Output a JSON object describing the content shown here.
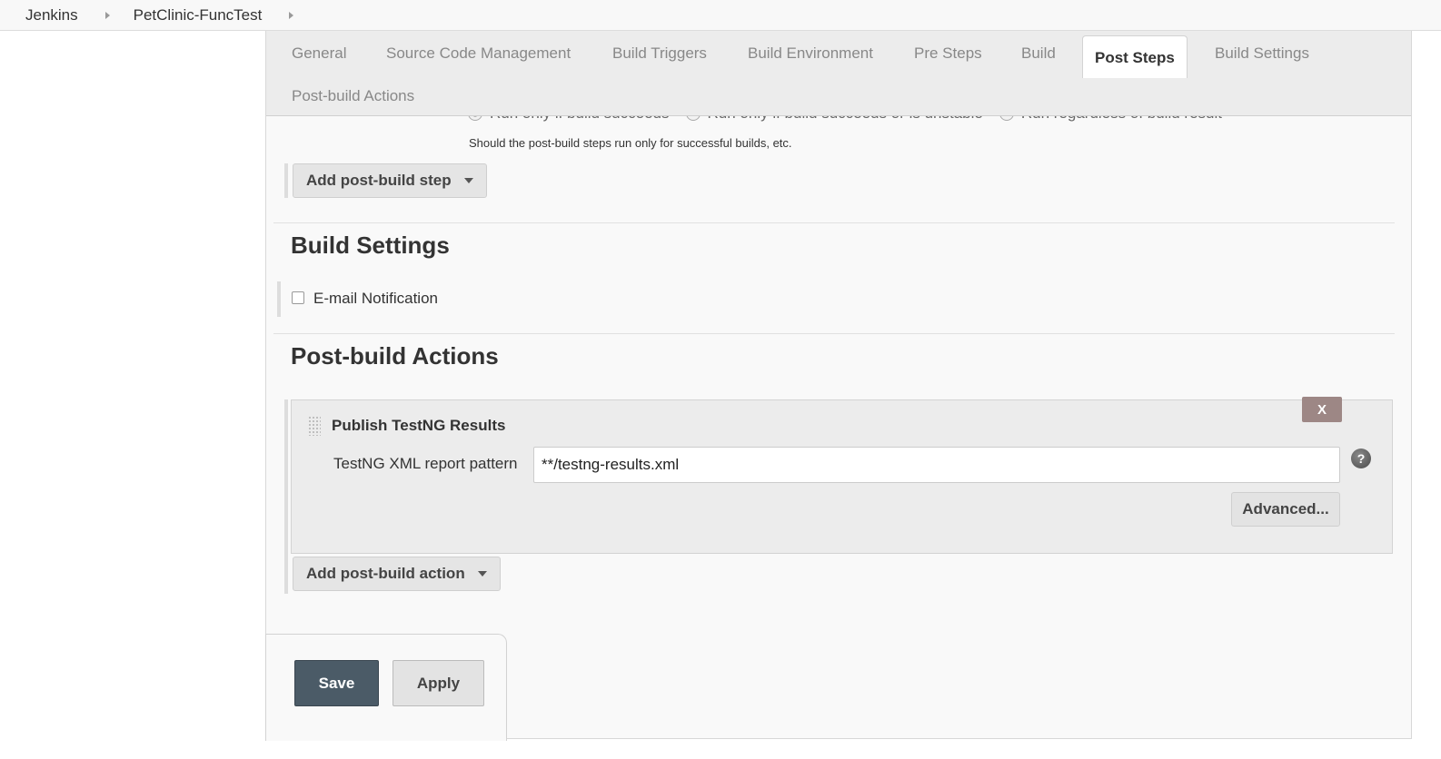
{
  "breadcrumb": {
    "items": [
      "Jenkins",
      "PetClinic-FuncTest"
    ]
  },
  "tabs": [
    {
      "label": "General",
      "active": false
    },
    {
      "label": "Source Code Management",
      "active": false
    },
    {
      "label": "Build Triggers",
      "active": false
    },
    {
      "label": "Build Environment",
      "active": false
    },
    {
      "label": "Pre Steps",
      "active": false
    },
    {
      "label": "Build",
      "active": false
    },
    {
      "label": "Post Steps",
      "active": true
    },
    {
      "label": "Build Settings",
      "active": false
    },
    {
      "label": "Post-build Actions",
      "active": false
    }
  ],
  "post_steps": {
    "run_options": [
      {
        "label": "Run only if build succeeds",
        "selected": true
      },
      {
        "label": "Run only if build succeeds or is unstable",
        "selected": false
      },
      {
        "label": "Run regardless of build result",
        "selected": false
      }
    ],
    "help_text": "Should the post-build steps run only for successful builds, etc.",
    "add_step_label": "Add post-build step"
  },
  "build_settings": {
    "title": "Build Settings",
    "email_notification_label": "E-mail Notification",
    "email_notification_checked": false
  },
  "post_build_actions": {
    "title": "Post-build Actions",
    "action_title": "Publish TestNG Results",
    "remove_label": "X",
    "field_label": "TestNG XML report pattern",
    "field_value": "**/testng-results.xml",
    "help_icon": "question-mark-icon",
    "advanced_label": "Advanced...",
    "add_action_label": "Add post-build action"
  },
  "buttons": {
    "save_label": "Save",
    "apply_label": "Apply"
  },
  "colors": {
    "save_button": "#4b5b67",
    "remove_button": "#9d8785",
    "tab_bar": "#ececec"
  }
}
